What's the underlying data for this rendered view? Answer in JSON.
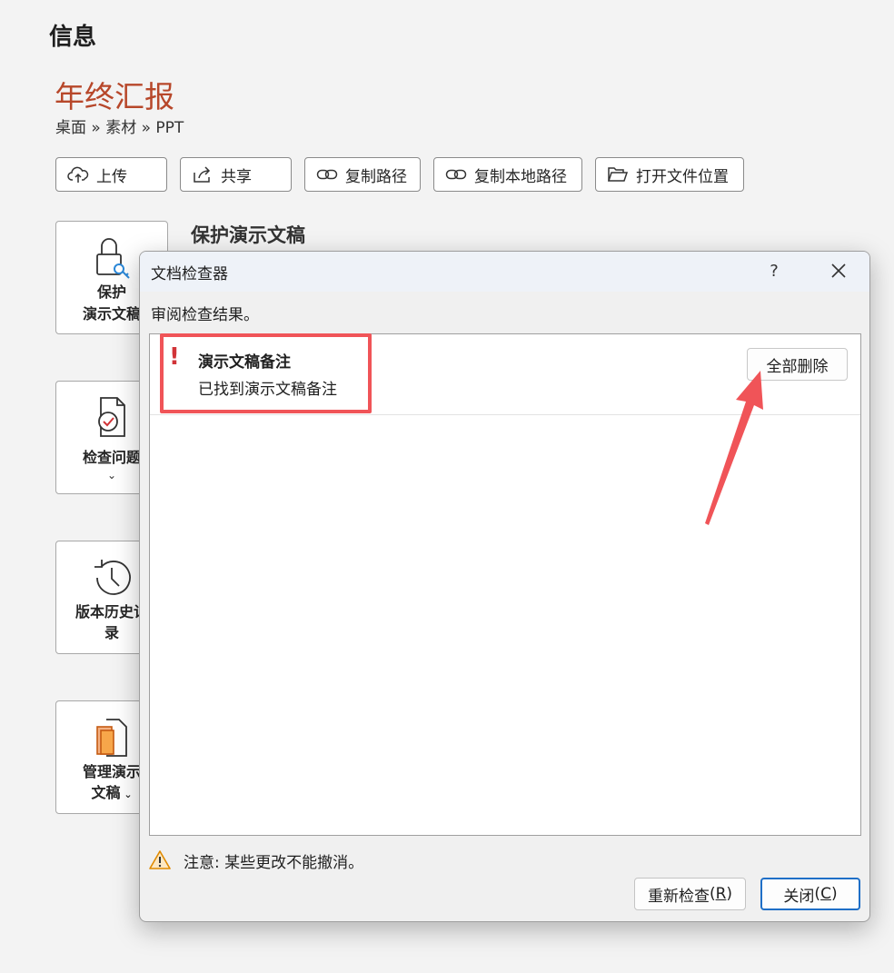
{
  "page": {
    "heading": "信息"
  },
  "document": {
    "title": "年终汇报",
    "breadcrumb": "桌面 » 素材 » PPT"
  },
  "toolbar": {
    "upload_label": "上传",
    "share_label": "共享",
    "copy_path_label": "复制路径",
    "copy_local_path_label": "复制本地路径",
    "open_location_label": "打开文件位置"
  },
  "section": {
    "protect_title": "保护演示文稿"
  },
  "side_cards": {
    "protect": "保护\n演示文稿",
    "inspect": "检查问题",
    "version": "版本历史记\n录",
    "manage": "管理演示\n文稿"
  },
  "dialog": {
    "title": "文档检查器",
    "help": "?",
    "instruction": "审阅检查结果。",
    "result": {
      "marker": "!",
      "title": "演示文稿备注",
      "description": "已找到演示文稿备注",
      "action_label": "全部删除"
    },
    "note": "注意: 某些更改不能撤消。",
    "reinspect_label": "重新检查",
    "reinspect_key": "R",
    "close_label": "关闭",
    "close_key": "C"
  },
  "colors": {
    "accent": "#b7472a",
    "highlight": "#f05458",
    "focus": "#1f6fc7",
    "warning": "#d13438"
  }
}
